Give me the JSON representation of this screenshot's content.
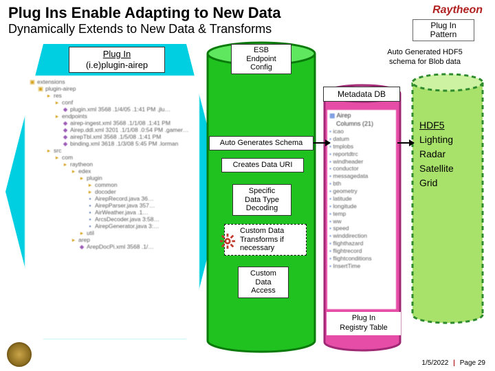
{
  "title": "Plug Ins Enable Adapting to New Data",
  "subtitle": "Dynamically Extends to New Data & Transforms",
  "brand": "Raytheon",
  "pattern_box_l1": "Plug In",
  "pattern_box_l2": "Pattern",
  "auto_hdf5_l1": "Auto Generated HDF5",
  "auto_hdf5_l2": "schema for Blob data",
  "plugin_label_l1": "Plug In",
  "plugin_label_l2": "(i.e)plugin-airep",
  "center": {
    "esb_l1": "ESB",
    "esb_l2": "Endpoint",
    "esb_l3": "Config",
    "auto_gen": "Auto Generates Schema",
    "creates_uri": "Creates Data URI",
    "specific_l1": "Specific",
    "specific_l2": "Data Type",
    "specific_l3": "Decoding",
    "custom_tx_l1": "Custom Data",
    "custom_tx_l2": "Transforms if",
    "custom_tx_l3": "necessary",
    "custom_da_l1": "Custom",
    "custom_da_l2": "Data",
    "custom_da_l3": "Access"
  },
  "meta_label": "Metadata DB",
  "plugin_registry_l1": "Plug In",
  "plugin_registry_l2": "Registry Table",
  "hdf5": {
    "title": "HDF5",
    "i1": "Lighting",
    "i2": "Radar",
    "i3": "Satellite",
    "i4": "Grid"
  },
  "tree": {
    "r": [
      "extensions",
      "plugin-airep",
      "res",
      "conf",
      "plugin.xml 3568 .1/4/05 .1:41 PM .jlu…",
      "endpoints",
      "airep-ingest.xml 3568 .1/1/08 .1:41 PM",
      "Airep.ddl.xml 3201 .1/1/08 .0:54 PM .gamer…",
      "airepTbl.xml 3568 .1/5/08 .1:41 PM",
      "binding.xml 3618 .1/3/08 5:45 PM .lorman",
      "src",
      "com",
      "raytheon",
      "edex",
      "plugin",
      "common",
      "docoder",
      "AirepRecord.java 36…",
      "AirepParser.java 357…",
      "AirWeather.java .1…",
      "ArcsDecoder.java 3:58…",
      "AirepGenerator.java 3:…",
      "util",
      "arep",
      "ArepDocPi.xml 3568 .1/… "
    ]
  },
  "cols": {
    "hd": "Airep",
    "sub": "Columns (21)",
    "items": [
      "icao",
      "datum",
      "tmplobs",
      "reportdtrc",
      "windheader",
      "conductor",
      "messagedata",
      "bth",
      "geometry",
      "latitude",
      "longitude",
      "temp",
      "ww",
      "speed",
      "winddirection",
      "flighthazard",
      "flightrecord",
      "flightconditions",
      "InsertTime",
      "…"
    ]
  },
  "footer_date": "1/5/2022",
  "footer_page": "Page 29"
}
